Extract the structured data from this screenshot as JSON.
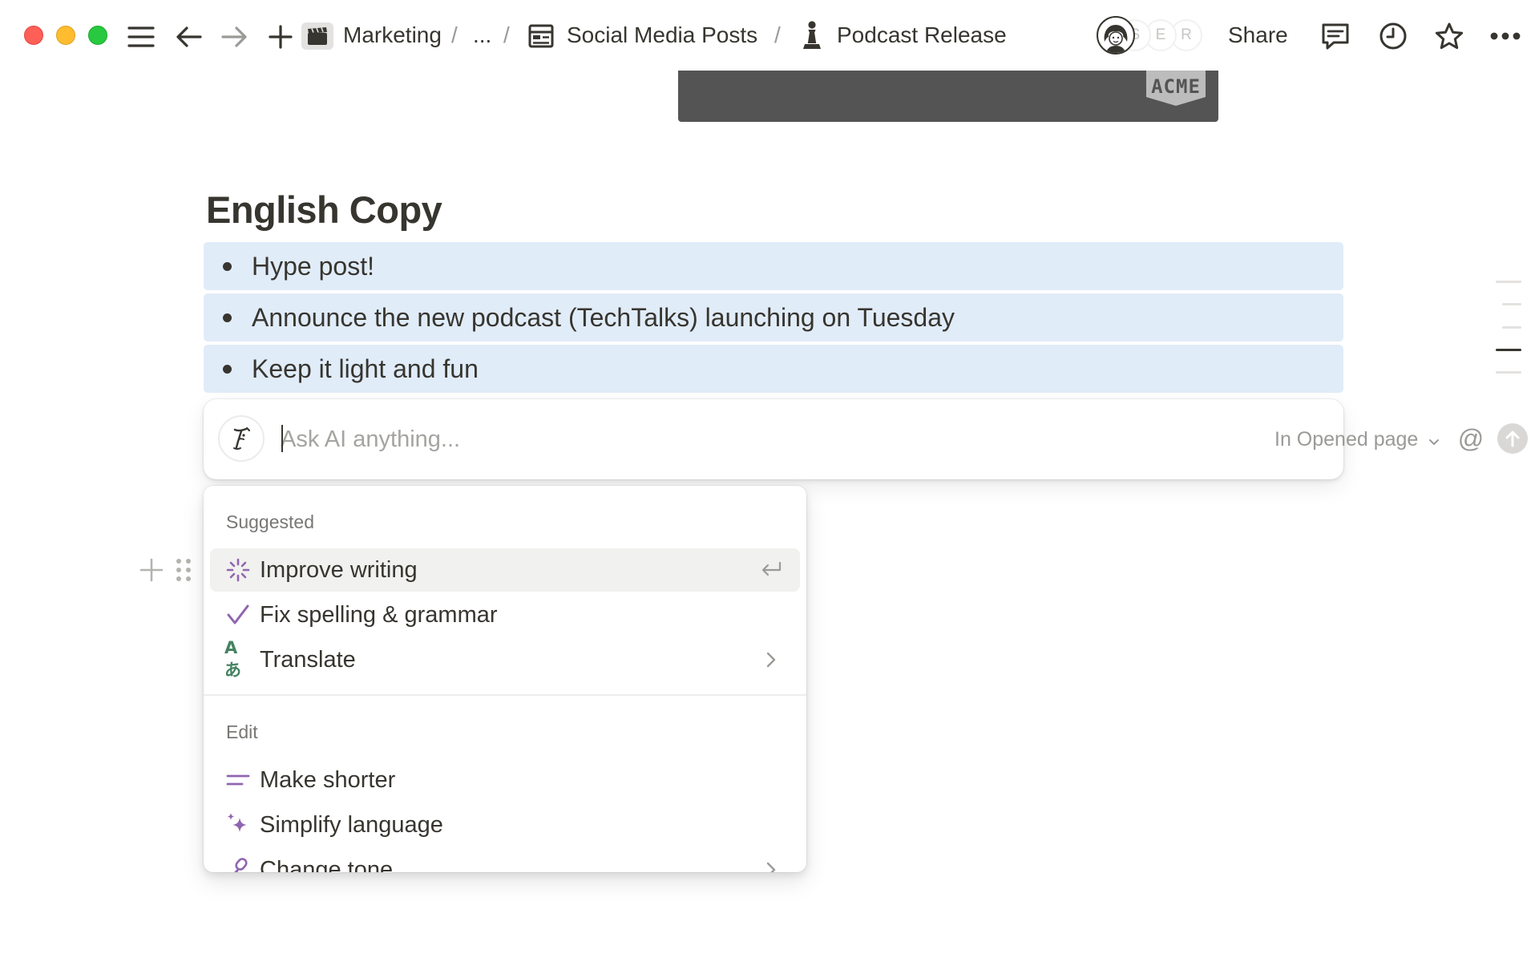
{
  "window": {
    "traffic_lights": {
      "close": "#fe5f57",
      "minimize": "#febc2e",
      "zoom": "#28c840"
    }
  },
  "topbar": {
    "breadcrumbs": [
      {
        "label": "Marketing",
        "icon": "clapperboard-icon"
      },
      {
        "label": "..."
      },
      {
        "label": "Social Media Posts",
        "icon": "database-table-icon"
      },
      {
        "label": "Podcast Release",
        "icon": "chess-pawn-icon"
      }
    ],
    "separator": "/",
    "avatars": [
      "S",
      "E",
      "R"
    ],
    "share_label": "Share",
    "icons": [
      "menu-icon",
      "back-arrow-icon",
      "forward-arrow-icon",
      "new-page-plus-icon",
      "comments-icon",
      "history-clock-icon",
      "favorite-star-icon",
      "more-dots-icon"
    ]
  },
  "cover": {
    "logo_text": "ACME",
    "color": "#555455"
  },
  "page": {
    "heading": "English Copy",
    "bullets": [
      "Hype post!",
      "Announce the new podcast (TechTalks) launching on Tuesday",
      "Keep it light and fun"
    ],
    "selection_color": "#e1ecf9"
  },
  "ai_prompt": {
    "placeholder": "Ask AI anything...",
    "value": "",
    "scope_label": "In Opened page",
    "mention_symbol": "@"
  },
  "ai_menu": {
    "sections": [
      {
        "label": "Suggested",
        "items": [
          {
            "label": "Improve writing",
            "icon": "sparkle-burst-icon",
            "right": "enter-key-icon",
            "active": true
          },
          {
            "label": "Fix spelling & grammar",
            "icon": "checkmark-icon"
          },
          {
            "label": "Translate",
            "icon": "translate-icon",
            "right": "chevron-right-icon"
          }
        ]
      },
      {
        "label": "Edit",
        "items": [
          {
            "label": "Make shorter",
            "icon": "short-lines-icon"
          },
          {
            "label": "Simplify language",
            "icon": "sparkles-icon"
          },
          {
            "label": "Change tone",
            "icon": "microphone-icon",
            "right": "chevron-right-icon"
          }
        ]
      }
    ],
    "translate_glyph": "Aあ",
    "accent_color": "#9065b0"
  }
}
